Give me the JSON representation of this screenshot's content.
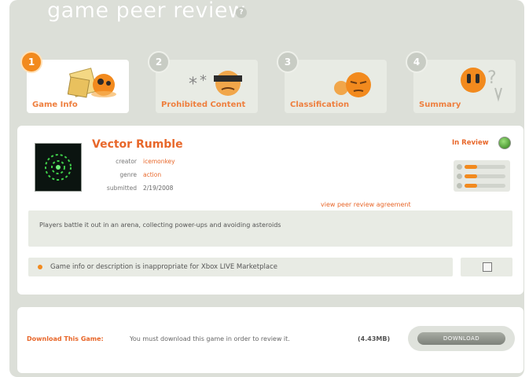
{
  "header": {
    "title": "game peer review",
    "help_glyph": "?"
  },
  "tabs": [
    {
      "number": "1",
      "label": "Game Info",
      "active": true
    },
    {
      "number": "2",
      "label": "Prohibited Content",
      "active": false
    },
    {
      "number": "3",
      "label": "Classification",
      "active": false
    },
    {
      "number": "4",
      "label": "Summary",
      "active": false
    }
  ],
  "game": {
    "title": "Vector Rumble",
    "creator_key": "creator",
    "creator_value": "icemonkey",
    "genre_key": "genre",
    "genre_value": "action",
    "submitted_key": "submitted",
    "submitted_value": "2/19/2008",
    "status": "In Review",
    "agreement_link": "view peer review agreement",
    "description": "Players battle it out in an arena, collecting power-ups and avoiding asteroids",
    "flag_text": "Game info or description is inappropriate for Xbox LIVE Marketplace",
    "progress": [
      0.3,
      0.3,
      0.3
    ]
  },
  "download": {
    "label": "Download This Game:",
    "text": "You must download this game in order to review it.",
    "size": "(4.43MB)",
    "button_label": "DOWNLOAD"
  },
  "colors": {
    "accent": "#e8672a",
    "tab_badge_active": "#f28a1e",
    "status_ok": "#3f9a22"
  }
}
